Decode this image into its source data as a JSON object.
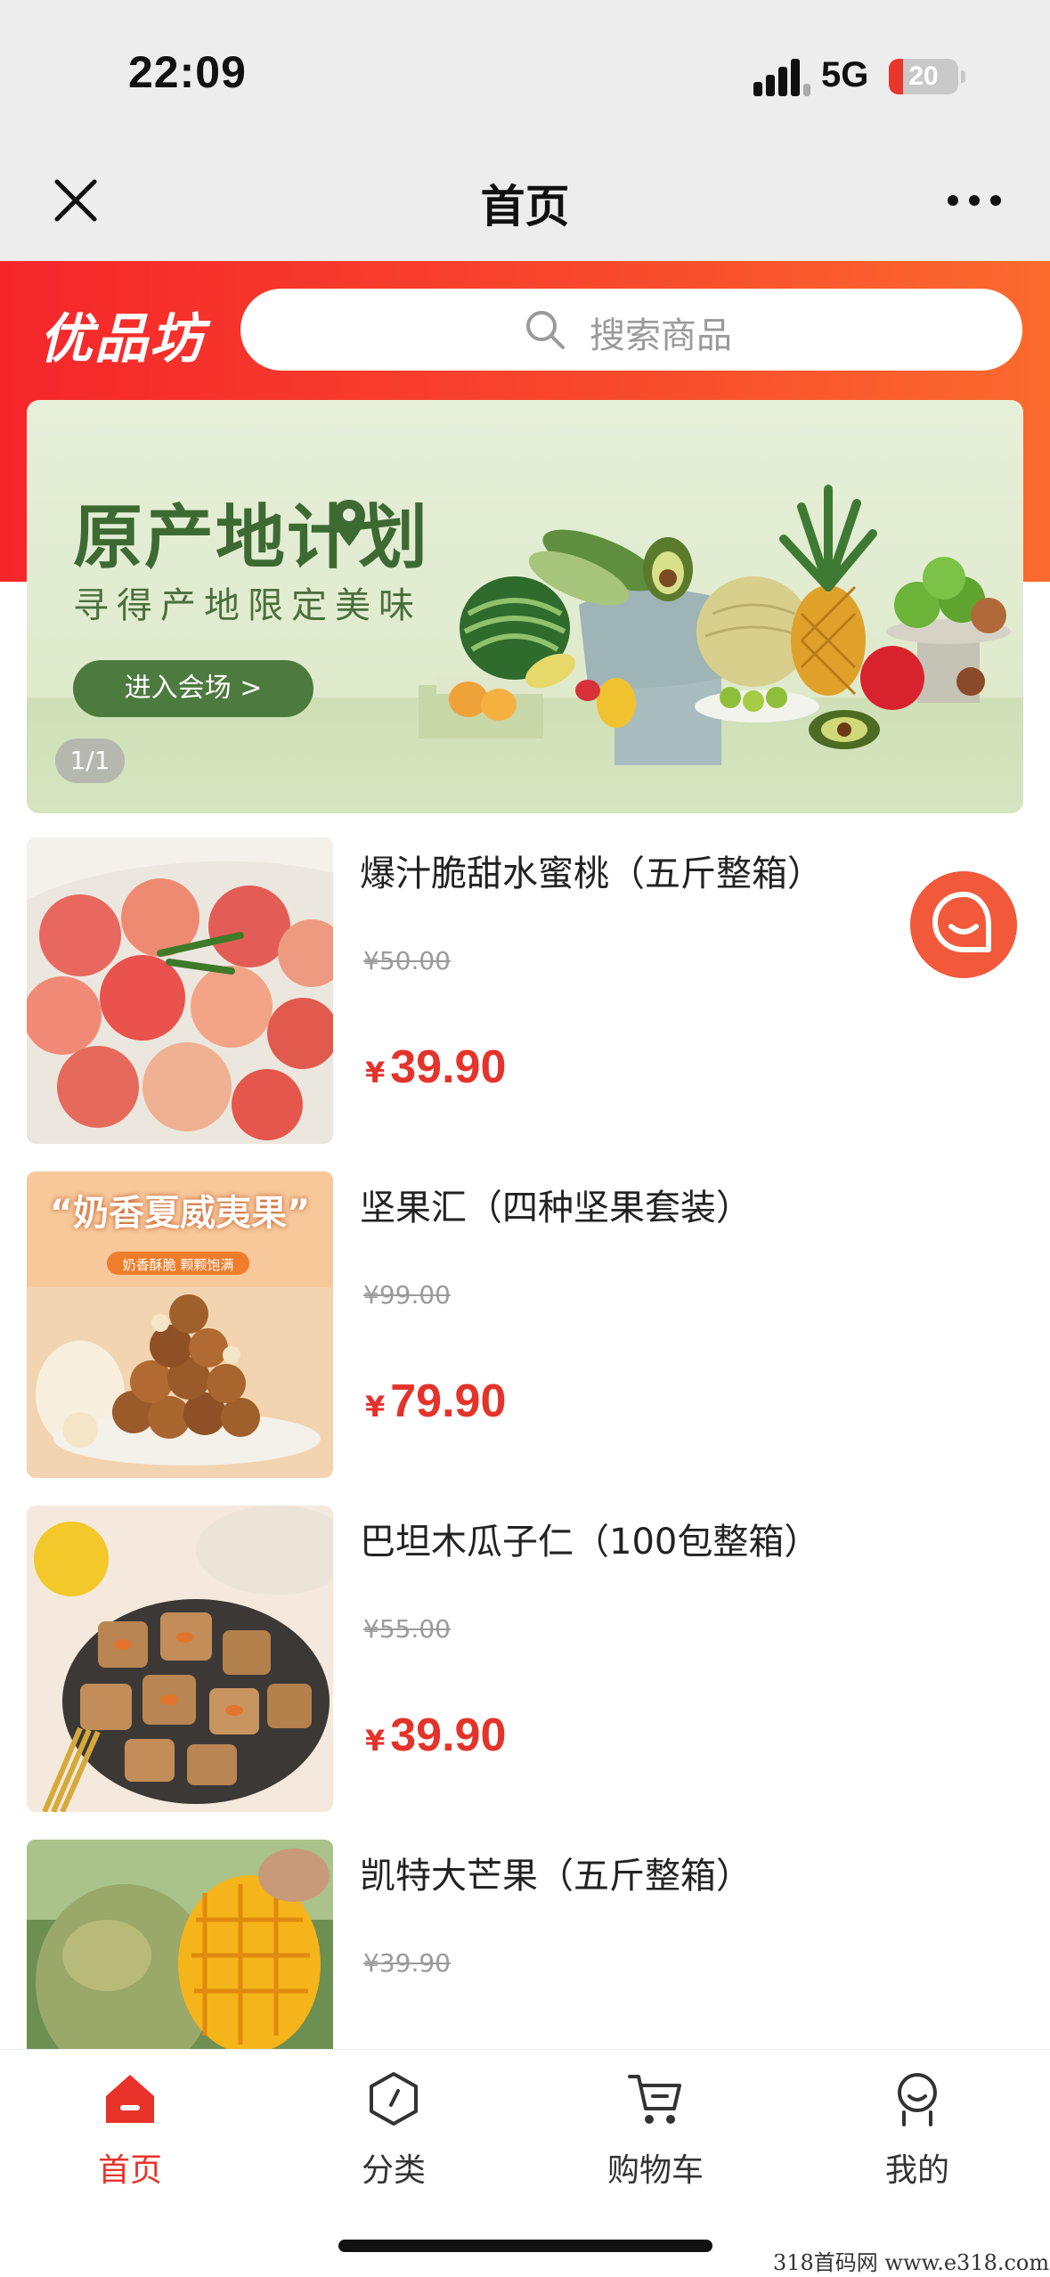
{
  "status_bar": {
    "time": "22:09",
    "network": "5G",
    "battery": "20",
    "battery_level": 0.2
  },
  "nav": {
    "title": "首页",
    "close_icon": "close-icon",
    "more_icon": "more-icon"
  },
  "header": {
    "logo": "优品坊",
    "search_placeholder": "搜索商品"
  },
  "banner": {
    "title": "原产地计划",
    "subtitle": "寻得产地限定美味",
    "button": "进入会场 >",
    "indicator": "1/1"
  },
  "products": [
    {
      "name": "爆汁脆甜水蜜桃（五斤整箱）",
      "original_price": "¥50.00",
      "currency": "¥",
      "price": "39.90"
    },
    {
      "name": "坚果汇（四种坚果套装）",
      "original_price": "¥99.00",
      "currency": "¥",
      "price": "79.90"
    },
    {
      "name": "巴坦木瓜子仁（100包整箱）",
      "original_price": "¥55.00",
      "currency": "¥",
      "price": "39.90"
    },
    {
      "name": "凯特大芒果（五斤整箱）",
      "original_price": "¥39.90",
      "currency": "¥",
      "price": ""
    }
  ],
  "product_images": {
    "p2_headline": "“奶香夏威夷果”",
    "p2_tag": "奶香酥脆 颗颗饱满"
  },
  "tabs": [
    {
      "label": "首页",
      "icon": "home-icon",
      "active": true
    },
    {
      "label": "分类",
      "icon": "category-icon",
      "active": false
    },
    {
      "label": "购物车",
      "icon": "cart-icon",
      "active": false
    },
    {
      "label": "我的",
      "icon": "profile-icon",
      "active": false
    }
  ],
  "watermark": "318首码网  www.e318.com",
  "colors": {
    "accent": "#e8332a",
    "header_red": "#f5262b",
    "banner_green": "#4c7a3f"
  }
}
